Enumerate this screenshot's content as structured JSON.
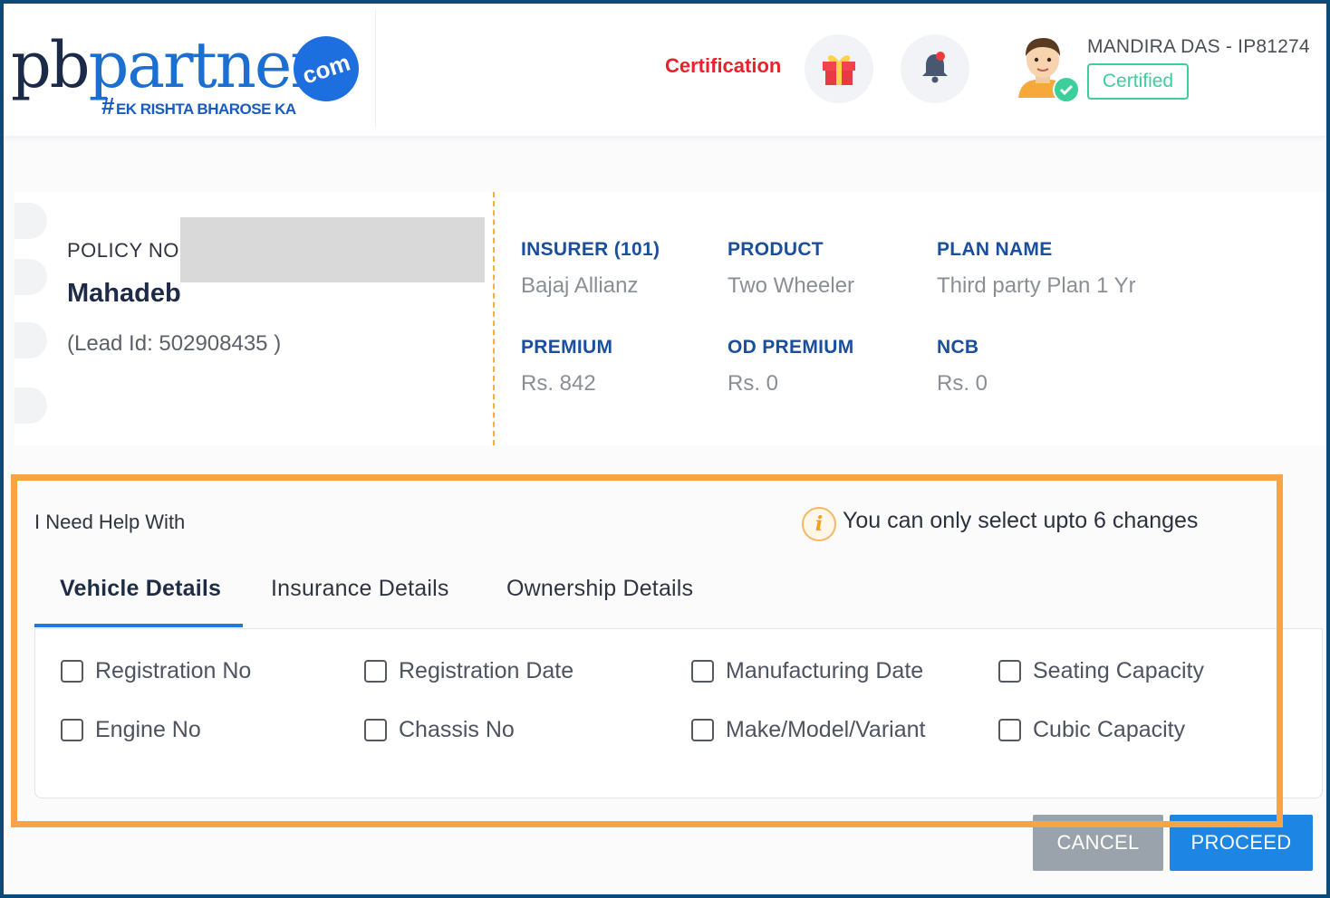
{
  "header": {
    "logo": {
      "brand_prefix": "pb",
      "brand_main": "partners",
      "brand_suffix": "com",
      "tagline_hash": "#",
      "tagline": "EK RISHTA BHAROSE KA"
    },
    "certification_link": "Certification",
    "gift_icon": "gift-icon",
    "bell_icon": "bell-icon",
    "user_name": "MANDIRA DAS - IP81274",
    "certified_badge": "Certified"
  },
  "policy": {
    "policy_no_label": "POLICY NO.",
    "holder_name": "Mahadeb",
    "lead_id": "(Lead Id: 502908435 )",
    "fields": [
      {
        "label": "INSURER (101)",
        "value": "Bajaj Allianz"
      },
      {
        "label": "PRODUCT",
        "value": "Two Wheeler"
      },
      {
        "label": "PLAN NAME",
        "value": "Third party Plan 1 Yr"
      },
      {
        "label": "PREMIUM",
        "value": "Rs. 842"
      },
      {
        "label": "OD PREMIUM",
        "value": "Rs. 0"
      },
      {
        "label": "NCB",
        "value": "Rs. 0"
      }
    ]
  },
  "help": {
    "title": "I Need Help With",
    "info_text": "You can only select upto 6 changes",
    "info_icon_glyph": "i",
    "tabs": [
      "Vehicle Details",
      "Insurance Details",
      "Ownership Details"
    ],
    "options": [
      "Registration No",
      "Registration Date",
      "Manufacturing Date",
      "Seating Capacity",
      "Engine No",
      "Chassis No",
      "Make/Model/Variant",
      "Cubic Capacity"
    ]
  },
  "actions": {
    "cancel": "CANCEL",
    "proceed": "PROCEED"
  },
  "colors": {
    "primary_blue": "#1d86e5",
    "highlight_orange": "#f7a544",
    "certified_green": "#3ccf9b",
    "cert_red": "#e8222c"
  }
}
